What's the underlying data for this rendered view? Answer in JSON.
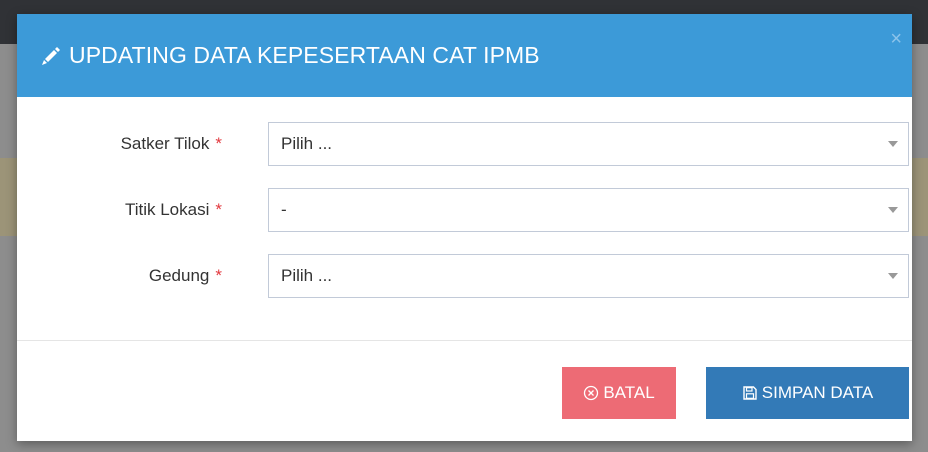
{
  "modal": {
    "title": "UPDATING DATA KEPESERTAAN CAT IPMB",
    "title_icon": "pencil-icon",
    "close_label": "×"
  },
  "form": {
    "required_marker": "*",
    "fields": [
      {
        "label": "Satker Tilok",
        "value": "Pilih ..."
      },
      {
        "label": "Titik Lokasi",
        "value": "-"
      },
      {
        "label": "Gedung",
        "value": "Pilih ..."
      }
    ]
  },
  "buttons": {
    "cancel_label": "BATAL",
    "cancel_icon": "circle-x-icon",
    "save_label": "SIMPAN DATA",
    "save_icon": "floppy-disk-icon"
  },
  "colors": {
    "header": "#3c9ad8",
    "cancel": "#ed6b75",
    "save": "#337ab7",
    "required": "#e2383e"
  }
}
